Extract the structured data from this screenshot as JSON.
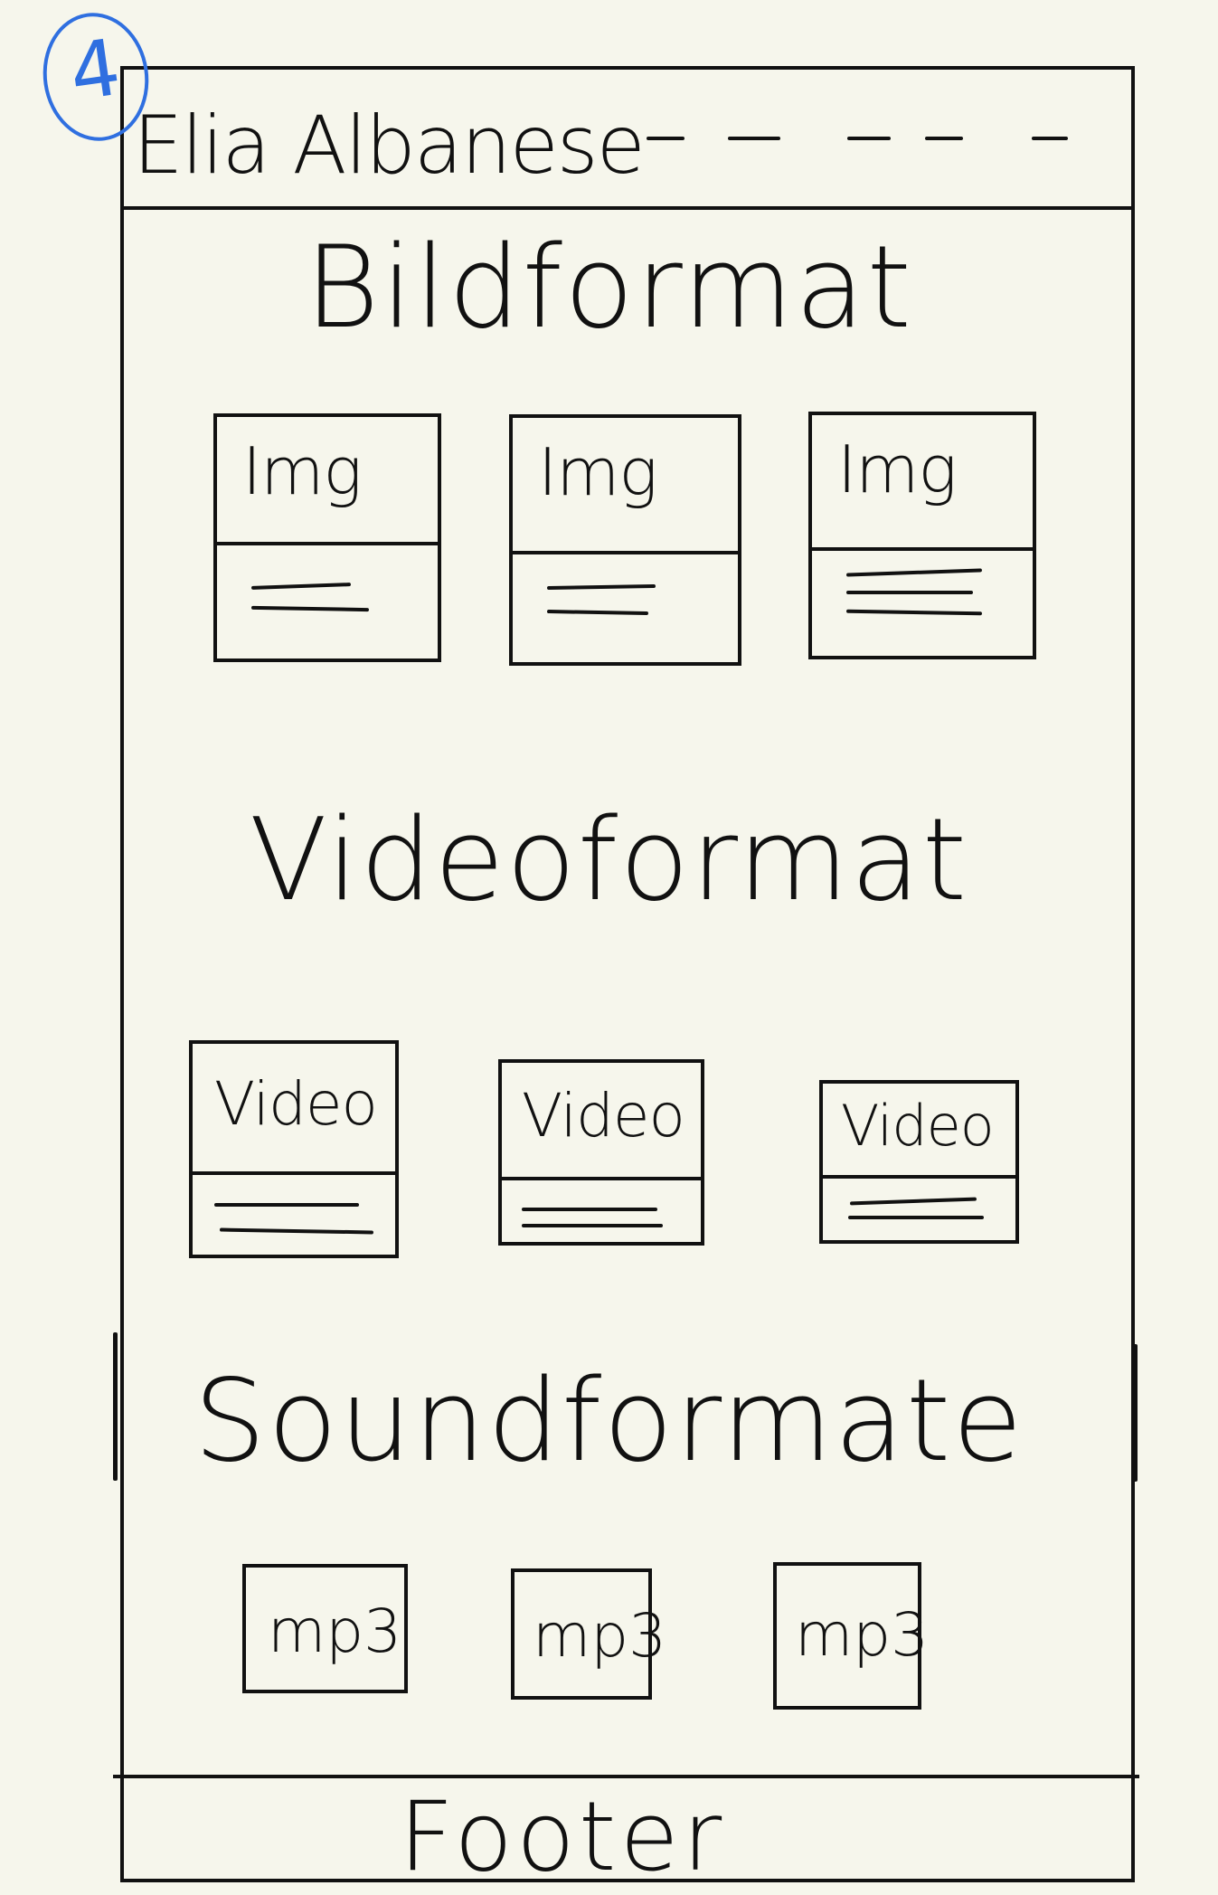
{
  "annotation": {
    "page_number": "4",
    "color": "#2f6fe0"
  },
  "header": {
    "title": "Elia Albanese",
    "nav_placeholders": 5
  },
  "sections": {
    "images": {
      "heading": "Bildformat",
      "card_labels": [
        "Img",
        "Img",
        "Img"
      ]
    },
    "videos": {
      "heading": "Videoformat",
      "card_labels": [
        "Video",
        "Video",
        "Video"
      ]
    },
    "sounds": {
      "heading": "Soundformate",
      "card_labels": [
        "mp3",
        "mp3",
        "mp3"
      ]
    }
  },
  "footer": {
    "label": "Footer"
  },
  "colors": {
    "ink": "#111111",
    "paper": "#f6f6ec",
    "annotation": "#2f6fe0"
  }
}
